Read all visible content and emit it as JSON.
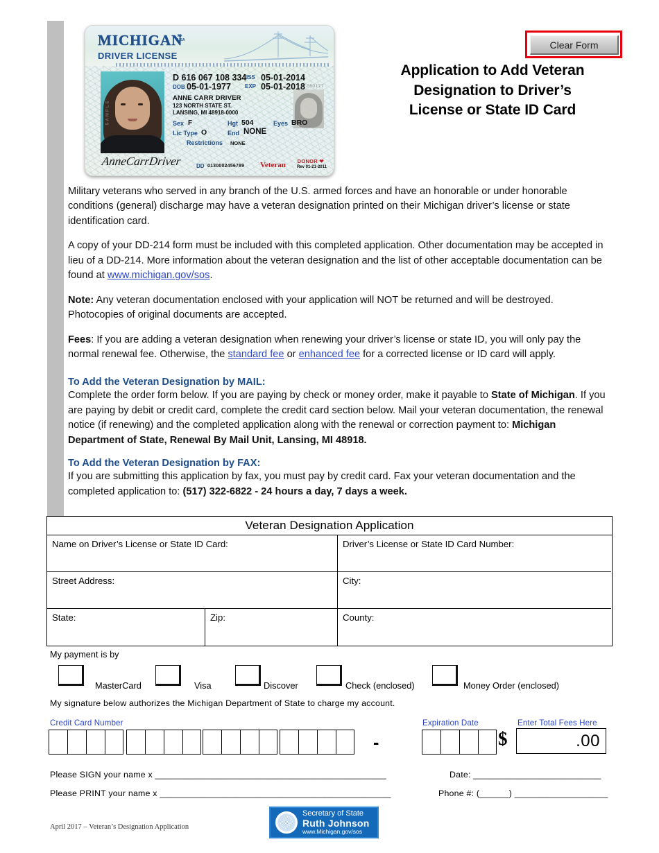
{
  "toolbar": {
    "clear_form_label": "Clear Form",
    "clear_form_border_color": "#e8000d"
  },
  "document": {
    "title_line1": "Application to Add Veteran",
    "title_line2": "Designation to Driver’s",
    "title_line3": "License or State ID Card",
    "footer_note": "April 2017 – Veteran’s Designation Application"
  },
  "license_card": {
    "state": "MICHIGAN",
    "state_sub_1": "MI",
    "state_sub_2": "USA",
    "card_type": "DRIVER LICENSE",
    "sample_watermark": "SAMPLE",
    "number": "D 616 067 108 334",
    "dob_label": "DOB",
    "dob_value": "05-01-1977",
    "iss_label": "ISS",
    "iss_value": "05-01-2014",
    "exp_label": "EXP",
    "exp_value": "05-01-2018",
    "aux_number": "050177",
    "name": "ANNE CARR DRIVER",
    "address_line1": "123 NORTH STATE ST.",
    "address_line2": "LANSING, MI 48918-0000",
    "sex_label": "Sex",
    "sex_value": "F",
    "hgt_label": "Hgt",
    "hgt_value": "504",
    "eyes_label": "Eyes",
    "eyes_value": "BRO",
    "lic_type_label": "Lic Type",
    "lic_type_value": "O",
    "end_label": "End",
    "end_value": "NONE",
    "restrictions_label": "Restrictions",
    "restrictions_value": "NONE",
    "signature": "AnneCarrDriver",
    "dd_label": "DD",
    "dd_value": "0130002456789",
    "veteran_mark": "Veteran",
    "donor_mark": "DONOR",
    "revision": "Rev 01-21-2011"
  },
  "intro": {
    "paragraph1": "Military veterans who served in any branch of the U.S. armed forces and have an honorable or under honorable conditions (general) discharge may have a veteran designation printed on their Michigan driver’s license or state identification card.",
    "paragraph2_part1": "A copy of your DD-214 form must be included with this completed application. Other documentation may be accepted in lieu of a DD-214. More information about the veteran designation and the list of other acceptable documentation can be found at ",
    "paragraph2_link": "www.michigan.gov/sos",
    "paragraph2_part2": ".",
    "note_label": "Note:",
    "note_text": " Any veteran documentation enclosed with your application will NOT be returned and will be destroyed. Photocopies of original documents are accepted.",
    "fees_label": "Fees",
    "fees_part1": ": If you are adding a veteran designation when renewing your driver’s license or state ID, you will only pay the normal renewal fee. Otherwise, the ",
    "fees_link1": "standard fee",
    "fees_mid": "  or ",
    "fees_link2": "enhanced fee",
    "fees_part2": " for a corrected license or ID card will apply."
  },
  "mail_section": {
    "heading": "To Add the Veteran Designation by MAIL:",
    "text_part1": "Complete the order form below. If you are paying by check or money order, make it payable to ",
    "bold1": "State of Michigan",
    "text_part2": ". If you are paying by debit or credit card, complete the credit card section below. Mail your veteran documentation, the renewal notice (if renewing) and the completed application along with the renewal or correction payment to: ",
    "bold2": "Michigan Department of State, Renewal By Mail Unit, Lansing, MI 48918."
  },
  "fax_section": {
    "heading": "To Add the Veteran Designation by FAX:",
    "text_part1": "If you are submitting this application by fax, you must pay by credit card. Fax your veteran documentation and the completed application to: ",
    "bold1": "(517) 322-6822 - 24 hours a day, 7 days a week."
  },
  "form_table": {
    "header": "Veteran Designation Application",
    "rows": [
      {
        "left_label": "Name on Driver’s License or State ID Card:",
        "right_label": "Driver’s License or State ID Card Number:"
      },
      {
        "left_label": "Street Address:",
        "right_label": "City:"
      }
    ],
    "row3": {
      "state_label": "State:",
      "zip_label": "Zip:",
      "county_label": "County:"
    }
  },
  "payment": {
    "prompt": "My payment is by",
    "options": [
      {
        "label": "MasterCard"
      },
      {
        "label": "Visa"
      },
      {
        "label": "Discover"
      },
      {
        "label": "Check (enclosed)"
      },
      {
        "label": "Money Order (enclosed)"
      }
    ],
    "authorization": "My signature below authorizes the Michigan Department of State to charge my account."
  },
  "credit_card": {
    "number_label": "Credit Card Number",
    "expiration_label": "Expiration Date",
    "fees_label": "Enter Total Fees Here",
    "dash": "-",
    "dollar_sign": "$",
    "fees_value": ".00",
    "label_color": "#2b46c9"
  },
  "signature_block": {
    "sign_label": "Please SIGN your name  x",
    "sign_rule": "_______________________________________________",
    "date_label": "Date:",
    "date_rule": "__________________________",
    "print_label": "Please PRINT your name x",
    "print_rule": "_______________________________________________",
    "phone_label": "Phone #: (______)",
    "phone_rule": "___________________"
  },
  "sos_logo": {
    "line1": "Secretary of State",
    "line2": "Ruth Johnson",
    "line3": "www.Michigan.gov/sos",
    "background": "#1569b9"
  }
}
